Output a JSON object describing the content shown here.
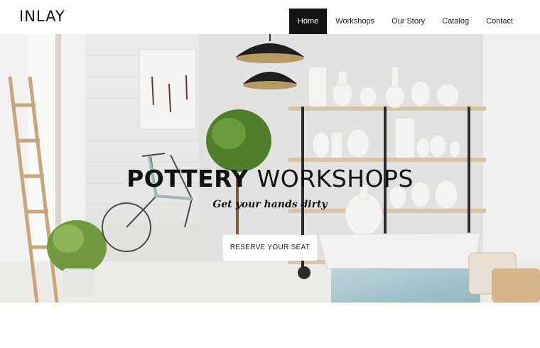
{
  "brand": {
    "logo_text": "INLAY"
  },
  "nav": {
    "items": [
      {
        "label": "Home",
        "active": true
      },
      {
        "label": "Workshops",
        "active": false
      },
      {
        "label": "Our Story",
        "active": false
      },
      {
        "label": "Catalog",
        "active": false
      },
      {
        "label": "Contact",
        "active": false
      }
    ]
  },
  "hero": {
    "title_bold": "POTTERY",
    "title_light": "WORKSHOPS",
    "subtitle": "Get your hands dirty",
    "cta_label": "RESERVE YOUR SEAT"
  },
  "colors": {
    "nav_active_bg": "#111111",
    "nav_active_text": "#ffffff",
    "text": "#111111",
    "background": "#ffffff"
  }
}
